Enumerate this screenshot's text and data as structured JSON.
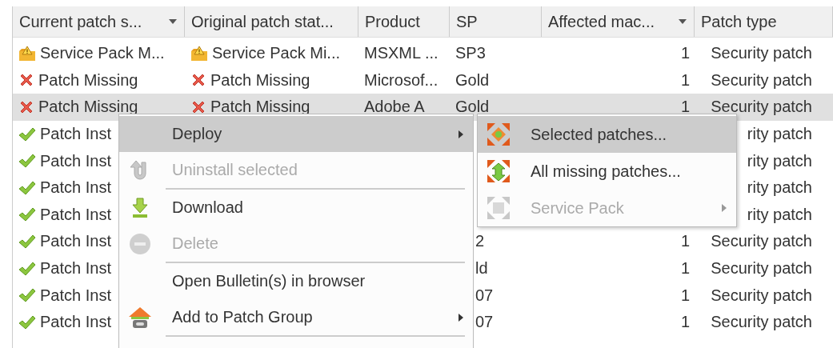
{
  "table": {
    "columns": [
      {
        "label": "Current patch s...",
        "sort": true
      },
      {
        "label": "Original patch stat...",
        "sort": false
      },
      {
        "label": "Product",
        "sort": false
      },
      {
        "label": "SP",
        "sort": false
      },
      {
        "label": "Affected mac...",
        "sort": true
      },
      {
        "label": "Patch type",
        "sort": false
      }
    ],
    "rows": [
      {
        "selected": false,
        "current": {
          "kind": "warning",
          "text": "Service Pack M..."
        },
        "original": {
          "kind": "warning",
          "text": "Service Pack Mi..."
        },
        "product": "MSXML ...",
        "sp": "SP3",
        "affected": "1",
        "patch_type": "Security patch"
      },
      {
        "selected": false,
        "current": {
          "kind": "missing",
          "text": "Patch Missing"
        },
        "original": {
          "kind": "missing",
          "text": "Patch Missing"
        },
        "product": "Microsof...",
        "sp": "Gold",
        "affected": "1",
        "patch_type": "Security patch"
      },
      {
        "selected": true,
        "current": {
          "kind": "missing",
          "text": "Patch Missing"
        },
        "original": {
          "kind": "missing",
          "text": "Patch Missing"
        },
        "product": "Adobe A",
        "sp": "Gold",
        "affected": "1",
        "patch_type": "Security patch"
      },
      {
        "selected": false,
        "current": {
          "kind": "installed",
          "text": "Patch Inst"
        },
        "patch_type": "rity patch"
      },
      {
        "selected": false,
        "current": {
          "kind": "installed",
          "text": "Patch Inst"
        },
        "patch_type": "rity patch"
      },
      {
        "selected": false,
        "current": {
          "kind": "installed",
          "text": "Patch Inst"
        },
        "patch_type": "rity patch"
      },
      {
        "selected": false,
        "current": {
          "kind": "installed",
          "text": "Patch Inst"
        },
        "patch_type": "rity patch"
      },
      {
        "selected": false,
        "current": {
          "kind": "installed",
          "text": "Patch Inst"
        },
        "sp": "2",
        "affected": "1",
        "patch_type": "Security patch"
      },
      {
        "selected": false,
        "current": {
          "kind": "installed",
          "text": "Patch Inst"
        },
        "sp": "ld",
        "affected": "1",
        "patch_type": "Security patch"
      },
      {
        "selected": false,
        "current": {
          "kind": "installed",
          "text": "Patch Inst"
        },
        "sp": "07",
        "affected": "1",
        "patch_type": "Security patch"
      },
      {
        "selected": false,
        "current": {
          "kind": "installed",
          "text": "Patch Inst"
        },
        "sp": "07",
        "affected": "1",
        "patch_type": "Security patch"
      }
    ]
  },
  "context_menu": {
    "items": [
      {
        "kind": "item",
        "label": "Deploy",
        "selected": true,
        "disabled": false,
        "submenu": true
      },
      {
        "kind": "item",
        "label": "Uninstall selected",
        "selected": false,
        "disabled": true,
        "submenu": false
      },
      {
        "kind": "separator"
      },
      {
        "kind": "item",
        "label": "Download",
        "selected": false,
        "disabled": false,
        "submenu": false
      },
      {
        "kind": "item",
        "label": "Delete",
        "selected": false,
        "disabled": true,
        "submenu": false
      },
      {
        "kind": "separator"
      },
      {
        "kind": "item",
        "label": "Open Bulletin(s) in browser",
        "selected": false,
        "disabled": false,
        "submenu": false
      },
      {
        "kind": "item",
        "label": "Add to Patch Group",
        "selected": false,
        "disabled": false,
        "submenu": true
      },
      {
        "kind": "separator"
      }
    ]
  },
  "deploy_submenu": {
    "items": [
      {
        "kind": "item",
        "label": "Selected patches...",
        "selected": true,
        "disabled": false,
        "submenu": false
      },
      {
        "kind": "item",
        "label": "All missing patches...",
        "selected": false,
        "disabled": false,
        "submenu": false
      },
      {
        "kind": "item",
        "label": "Service Pack",
        "selected": false,
        "disabled": true,
        "submenu": true
      }
    ]
  }
}
